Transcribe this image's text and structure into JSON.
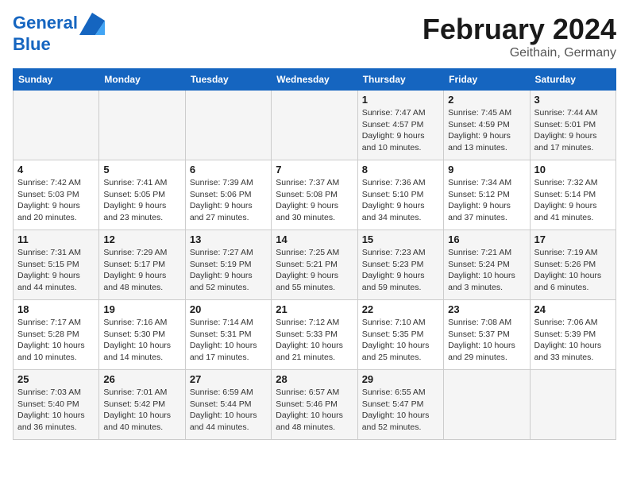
{
  "logo": {
    "line1": "General",
    "line2": "Blue"
  },
  "title": "February 2024",
  "subtitle": "Geithain, Germany",
  "days_header": [
    "Sunday",
    "Monday",
    "Tuesday",
    "Wednesday",
    "Thursday",
    "Friday",
    "Saturday"
  ],
  "weeks": [
    [
      {
        "day": "",
        "info": ""
      },
      {
        "day": "",
        "info": ""
      },
      {
        "day": "",
        "info": ""
      },
      {
        "day": "",
        "info": ""
      },
      {
        "day": "1",
        "info": "Sunrise: 7:47 AM\nSunset: 4:57 PM\nDaylight: 9 hours\nand 10 minutes."
      },
      {
        "day": "2",
        "info": "Sunrise: 7:45 AM\nSunset: 4:59 PM\nDaylight: 9 hours\nand 13 minutes."
      },
      {
        "day": "3",
        "info": "Sunrise: 7:44 AM\nSunset: 5:01 PM\nDaylight: 9 hours\nand 17 minutes."
      }
    ],
    [
      {
        "day": "4",
        "info": "Sunrise: 7:42 AM\nSunset: 5:03 PM\nDaylight: 9 hours\nand 20 minutes."
      },
      {
        "day": "5",
        "info": "Sunrise: 7:41 AM\nSunset: 5:05 PM\nDaylight: 9 hours\nand 23 minutes."
      },
      {
        "day": "6",
        "info": "Sunrise: 7:39 AM\nSunset: 5:06 PM\nDaylight: 9 hours\nand 27 minutes."
      },
      {
        "day": "7",
        "info": "Sunrise: 7:37 AM\nSunset: 5:08 PM\nDaylight: 9 hours\nand 30 minutes."
      },
      {
        "day": "8",
        "info": "Sunrise: 7:36 AM\nSunset: 5:10 PM\nDaylight: 9 hours\nand 34 minutes."
      },
      {
        "day": "9",
        "info": "Sunrise: 7:34 AM\nSunset: 5:12 PM\nDaylight: 9 hours\nand 37 minutes."
      },
      {
        "day": "10",
        "info": "Sunrise: 7:32 AM\nSunset: 5:14 PM\nDaylight: 9 hours\nand 41 minutes."
      }
    ],
    [
      {
        "day": "11",
        "info": "Sunrise: 7:31 AM\nSunset: 5:15 PM\nDaylight: 9 hours\nand 44 minutes."
      },
      {
        "day": "12",
        "info": "Sunrise: 7:29 AM\nSunset: 5:17 PM\nDaylight: 9 hours\nand 48 minutes."
      },
      {
        "day": "13",
        "info": "Sunrise: 7:27 AM\nSunset: 5:19 PM\nDaylight: 9 hours\nand 52 minutes."
      },
      {
        "day": "14",
        "info": "Sunrise: 7:25 AM\nSunset: 5:21 PM\nDaylight: 9 hours\nand 55 minutes."
      },
      {
        "day": "15",
        "info": "Sunrise: 7:23 AM\nSunset: 5:23 PM\nDaylight: 9 hours\nand 59 minutes."
      },
      {
        "day": "16",
        "info": "Sunrise: 7:21 AM\nSunset: 5:24 PM\nDaylight: 10 hours\nand 3 minutes."
      },
      {
        "day": "17",
        "info": "Sunrise: 7:19 AM\nSunset: 5:26 PM\nDaylight: 10 hours\nand 6 minutes."
      }
    ],
    [
      {
        "day": "18",
        "info": "Sunrise: 7:17 AM\nSunset: 5:28 PM\nDaylight: 10 hours\nand 10 minutes."
      },
      {
        "day": "19",
        "info": "Sunrise: 7:16 AM\nSunset: 5:30 PM\nDaylight: 10 hours\nand 14 minutes."
      },
      {
        "day": "20",
        "info": "Sunrise: 7:14 AM\nSunset: 5:31 PM\nDaylight: 10 hours\nand 17 minutes."
      },
      {
        "day": "21",
        "info": "Sunrise: 7:12 AM\nSunset: 5:33 PM\nDaylight: 10 hours\nand 21 minutes."
      },
      {
        "day": "22",
        "info": "Sunrise: 7:10 AM\nSunset: 5:35 PM\nDaylight: 10 hours\nand 25 minutes."
      },
      {
        "day": "23",
        "info": "Sunrise: 7:08 AM\nSunset: 5:37 PM\nDaylight: 10 hours\nand 29 minutes."
      },
      {
        "day": "24",
        "info": "Sunrise: 7:06 AM\nSunset: 5:39 PM\nDaylight: 10 hours\nand 33 minutes."
      }
    ],
    [
      {
        "day": "25",
        "info": "Sunrise: 7:03 AM\nSunset: 5:40 PM\nDaylight: 10 hours\nand 36 minutes."
      },
      {
        "day": "26",
        "info": "Sunrise: 7:01 AM\nSunset: 5:42 PM\nDaylight: 10 hours\nand 40 minutes."
      },
      {
        "day": "27",
        "info": "Sunrise: 6:59 AM\nSunset: 5:44 PM\nDaylight: 10 hours\nand 44 minutes."
      },
      {
        "day": "28",
        "info": "Sunrise: 6:57 AM\nSunset: 5:46 PM\nDaylight: 10 hours\nand 48 minutes."
      },
      {
        "day": "29",
        "info": "Sunrise: 6:55 AM\nSunset: 5:47 PM\nDaylight: 10 hours\nand 52 minutes."
      },
      {
        "day": "",
        "info": ""
      },
      {
        "day": "",
        "info": ""
      }
    ]
  ]
}
